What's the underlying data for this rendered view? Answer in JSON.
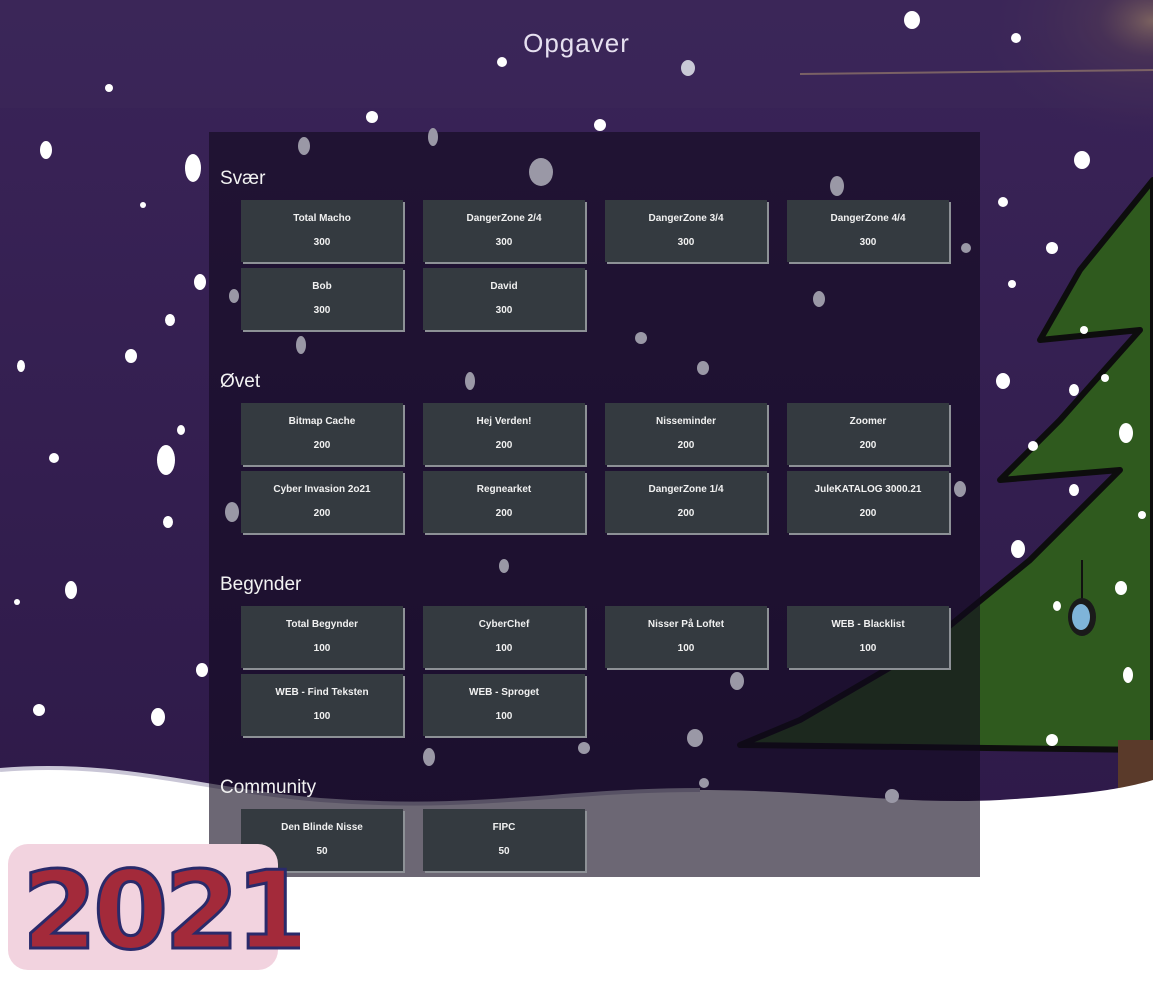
{
  "header": {
    "title": "Opgaver"
  },
  "categories": [
    {
      "title": "Svær",
      "challenges": [
        {
          "name": "Total Macho",
          "points": "300"
        },
        {
          "name": "DangerZone 2/4",
          "points": "300"
        },
        {
          "name": "DangerZone 3/4",
          "points": "300"
        },
        {
          "name": "DangerZone 4/4",
          "points": "300"
        },
        {
          "name": "Bob",
          "points": "300"
        },
        {
          "name": "David",
          "points": "300"
        }
      ]
    },
    {
      "title": "Øvet",
      "challenges": [
        {
          "name": "Bitmap Cache",
          "points": "200"
        },
        {
          "name": "Hej Verden!",
          "points": "200"
        },
        {
          "name": "Nisseminder",
          "points": "200"
        },
        {
          "name": "Zoomer",
          "points": "200"
        },
        {
          "name": "Cyber Invasion 2o21",
          "points": "200"
        },
        {
          "name": "Regnearket",
          "points": "200"
        },
        {
          "name": "DangerZone 1/4",
          "points": "200"
        },
        {
          "name": "JuleKATALOG 3000.21",
          "points": "200"
        }
      ]
    },
    {
      "title": "Begynder",
      "challenges": [
        {
          "name": "Total Begynder",
          "points": "100"
        },
        {
          "name": "CyberChef",
          "points": "100"
        },
        {
          "name": "Nisser På Loftet",
          "points": "100"
        },
        {
          "name": "WEB - Blacklist",
          "points": "100"
        },
        {
          "name": "WEB - Find Teksten",
          "points": "100"
        },
        {
          "name": "WEB - Sproget",
          "points": "100"
        }
      ]
    },
    {
      "title": "Community",
      "challenges": [
        {
          "name": "Den Blinde Nisse",
          "points": "50"
        },
        {
          "name": "FIPC",
          "points": "50"
        }
      ]
    }
  ],
  "decor": {
    "year_logo": "2021",
    "colors": {
      "night": "#2e1a4a",
      "card": "#343a40",
      "tree": "#2f5a1e",
      "snow": "#ffffff"
    }
  }
}
